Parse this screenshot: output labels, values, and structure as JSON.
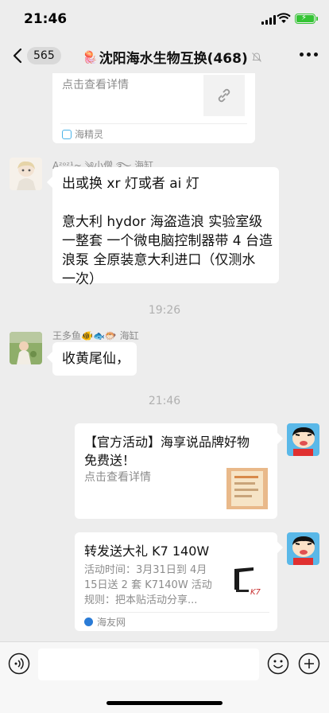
{
  "status_bar": {
    "time": "21:46"
  },
  "nav": {
    "unread_count": "565",
    "title_emoji": "🪼",
    "title": "沈阳海水生物互换(468)"
  },
  "messages": {
    "card_top": {
      "link_text": "点击查看详情",
      "source": "海精灵"
    },
    "msg1": {
      "sender": "Aᶻᵒᶻ¹~ ༄小僧 ࿐ 海缸",
      "lines": [
        "出或换 xr 灯或者 ai 灯",
        "",
        "意大利 hydor 海盗造浪 实验室级",
        "一整套 一个微电脑控制器带 4 台造",
        "浪泵 全原装意大利进口（仅测水",
        "一次）"
      ]
    },
    "time1": "19:26",
    "msg2": {
      "sender": "王多鱼🐠🐟🐡 海缸",
      "text": "收黄尾仙，"
    },
    "time2": "21:46",
    "card1": {
      "title_line1": "【官方活动】海享说品牌好物",
      "title_line2": "免费送！",
      "link_text": "点击查看详情"
    },
    "card2": {
      "title": "转发送大礼 K7 140W",
      "desc_lines": [
        "活动时间：3月31日到 4月",
        "15日送 2 套 K7140W 活动",
        "规则：把本贴活动分享..."
      ],
      "source": "海友网"
    }
  }
}
